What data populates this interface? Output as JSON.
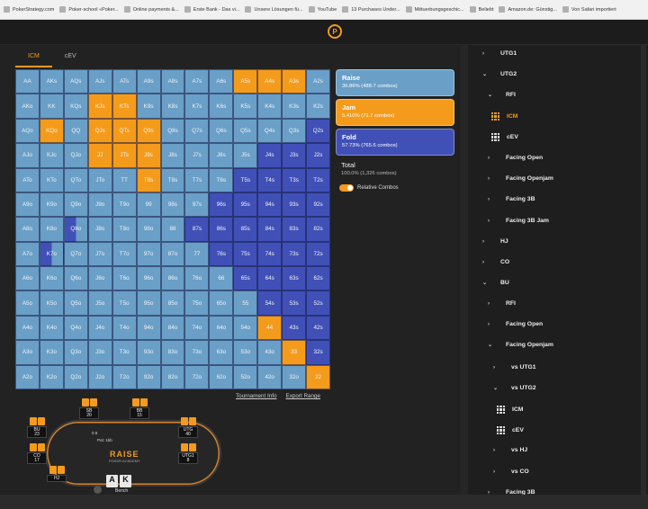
{
  "bookmarks": [
    "PokerStrategy.com",
    "Poker-school «Poker...",
    "Online payments &...",
    "Erste Bank - Das vi...",
    "Unsere Lösungen fü...",
    "YouTube",
    "13 Purchases Under...",
    "Mittuerbungsgeschic...",
    "Beliebt",
    "Amazon.de: Günstig...",
    "Von Safari importiert"
  ],
  "logo": "P",
  "tabs": [
    "ICM",
    "cEV"
  ],
  "grid": {
    "labels": [
      [
        "AA",
        "AKs",
        "AQs",
        "AJs",
        "ATs",
        "A9s",
        "A8s",
        "A7s",
        "A6s",
        "A5s",
        "A4s",
        "A3s",
        "A2s"
      ],
      [
        "AKo",
        "KK",
        "KQs",
        "KJs",
        "KTs",
        "K9s",
        "K8s",
        "K7s",
        "K6s",
        "K5s",
        "K4s",
        "K3s",
        "K2s"
      ],
      [
        "AQo",
        "KQo",
        "QQ",
        "QJs",
        "QTs",
        "Q9s",
        "Q8s",
        "Q7s",
        "Q6s",
        "Q5s",
        "Q4s",
        "Q3s",
        "Q2s"
      ],
      [
        "AJo",
        "KJo",
        "QJo",
        "JJ",
        "JTs",
        "J9s",
        "J8s",
        "J7s",
        "J6s",
        "J5s",
        "J4s",
        "J3s",
        "J2s"
      ],
      [
        "ATo",
        "KTo",
        "QTo",
        "JTo",
        "TT",
        "T9s",
        "T8s",
        "T7s",
        "T6s",
        "T5s",
        "T4s",
        "T3s",
        "T2s"
      ],
      [
        "A9o",
        "K9o",
        "Q9o",
        "J9o",
        "T9o",
        "99",
        "98s",
        "97s",
        "96s",
        "95s",
        "94s",
        "93s",
        "92s"
      ],
      [
        "A8o",
        "K8o",
        "Q8o",
        "J8o",
        "T8o",
        "98o",
        "88",
        "87s",
        "86s",
        "85s",
        "84s",
        "83s",
        "82s"
      ],
      [
        "A7o",
        "K7o",
        "Q7o",
        "J7o",
        "T7o",
        "97o",
        "87o",
        "77",
        "76s",
        "75s",
        "74s",
        "73s",
        "72s"
      ],
      [
        "A6o",
        "K6o",
        "Q6o",
        "J6o",
        "T6o",
        "96o",
        "86o",
        "76o",
        "66",
        "65s",
        "64s",
        "63s",
        "62s"
      ],
      [
        "A5o",
        "K5o",
        "Q5o",
        "J5o",
        "T5o",
        "95o",
        "85o",
        "75o",
        "65o",
        "55",
        "54s",
        "53s",
        "52s"
      ],
      [
        "A4o",
        "K4o",
        "Q4o",
        "J4o",
        "T4o",
        "94o",
        "84o",
        "74o",
        "64o",
        "54o",
        "44",
        "43s",
        "42s"
      ],
      [
        "A3o",
        "K3o",
        "Q3o",
        "J3o",
        "T3o",
        "93o",
        "83o",
        "73o",
        "63o",
        "53o",
        "43o",
        "33",
        "32s"
      ],
      [
        "A2o",
        "K2o",
        "Q2o",
        "J2o",
        "T2o",
        "92o",
        "82o",
        "72o",
        "62o",
        "52o",
        "42o",
        "32o",
        "22"
      ]
    ],
    "actions": [
      "RRRRRRRRRJJJR",
      "RRRJJRRRRRRRR",
      "RJRJJJRRRRRRF",
      "RRRJJJRRRRFFF",
      "RRRRRJRRRFFFF",
      "RRRRRRRRFFFFF",
      "RRMRRRRFFFFFF",
      "RMRRRRRRFFFFF",
      "RRRRRRRRRFFFF",
      "RRRRRRRRRRFFF",
      "RRRRRRRRRRJFF",
      "RRRRRRRRRRRJF",
      "RRRRRRRRRRRRJ"
    ]
  },
  "colors": {
    "raise": "#6a9fc7",
    "jam": "#f59b1b",
    "fold": "#4150b7",
    "accent": "#f39a1f"
  },
  "links": {
    "info": "Tournament Info",
    "export": "Export Range"
  },
  "legend": [
    {
      "name": "Raise",
      "value": "36.86% (488.7 combos)"
    },
    {
      "name": "Jam",
      "value": "5.410% (71.7 combos)"
    },
    {
      "name": "Fold",
      "value": "57.73% (765.6 combos)"
    }
  ],
  "total": {
    "name": "Total",
    "value": "100.0% (1,326 combos)"
  },
  "relative_label": "Relative Combos",
  "seats": [
    {
      "name": "SB",
      "stack": "20"
    },
    {
      "name": "BB",
      "stack": "15"
    },
    {
      "name": "BU",
      "stack": "23"
    },
    {
      "name": "UTG",
      "stack": "40"
    },
    {
      "name": "CO",
      "stack": "17"
    },
    {
      "name": "UTG1",
      "stack": "8"
    },
    {
      "name": "HJ",
      "stack": ""
    }
  ],
  "table": {
    "brand": "RAISE",
    "sub": "POKER ACADEMY",
    "pot": "0.5",
    "ante": "Pot: 1bb",
    "hero_cards": [
      "A",
      "K"
    ],
    "hero_name": "Bench"
  },
  "nav": [
    {
      "label": "UTG1",
      "chev": "›"
    },
    {
      "label": "UTG2",
      "chev": "⌄"
    },
    {
      "label": "RFI",
      "chev": "⌄"
    },
    {
      "label": "ICM",
      "chev": ""
    },
    {
      "label": "cEV",
      "chev": ""
    },
    {
      "label": "Facing Open",
      "chev": "›"
    },
    {
      "label": "Facing Openjam",
      "chev": "›"
    },
    {
      "label": "Facing 3B",
      "chev": "›"
    },
    {
      "label": "Facing 3B Jam",
      "chev": "›"
    },
    {
      "label": "HJ",
      "chev": "›"
    },
    {
      "label": "CO",
      "chev": "›"
    },
    {
      "label": "BU",
      "chev": "⌄"
    },
    {
      "label": "RFI",
      "chev": "›"
    },
    {
      "label": "Facing Open",
      "chev": "›"
    },
    {
      "label": "Facing Openjam",
      "chev": "⌄"
    },
    {
      "label": "vs UTG1",
      "chev": "›"
    },
    {
      "label": "vs UTG2",
      "chev": "⌄"
    },
    {
      "label": "ICM",
      "chev": ""
    },
    {
      "label": "cEV",
      "chev": ""
    },
    {
      "label": "vs HJ",
      "chev": "›"
    },
    {
      "label": "vs CO",
      "chev": "›"
    },
    {
      "label": "Facing 3B",
      "chev": "›"
    }
  ]
}
